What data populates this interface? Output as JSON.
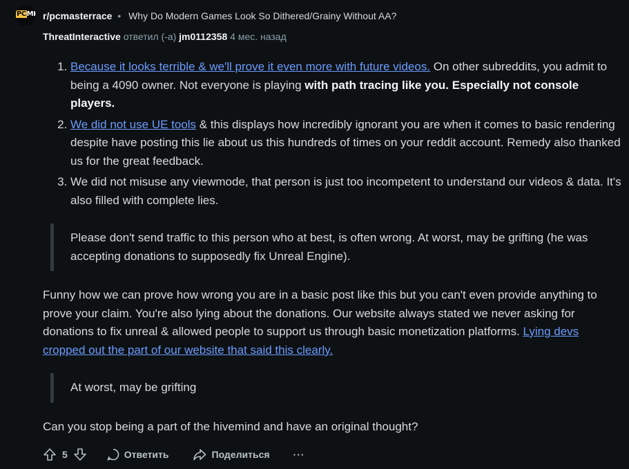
{
  "header": {
    "subreddit": "r/pcmasterrace",
    "separator": "•",
    "post_title": "Why Do Modern Games Look So Dithered/Grainy Without AA?",
    "author": "ThreatInteractive",
    "replied_text": "ответил (-а)",
    "reply_to": "jm0112358",
    "time_ago": "4 мес. назад",
    "avatar_text_a": "PC",
    "avatar_text_b": "MR"
  },
  "comment": {
    "list": [
      {
        "link": "Because it looks terrible & we'll prove it even more with future videos.",
        "text": " On other subreddits, you admit to being a 4090 owner. Not everyone is playing ",
        "bold": "with path tracing like you. Especially not console players."
      },
      {
        "link": "We did not use UE tools",
        "text": " & this displays how incredibly ignorant you are when it comes to basic rendering despite have posting this lie about us this hundreds of times on your reddit account. Remedy also thanked us for the great feedback."
      },
      {
        "text": "We did not misuse any viewmode, that person is just too incompetent to understand our videos & data. It's also filled with complete lies."
      }
    ],
    "quote1": "Please don't send traffic to this person who at best, is often wrong. At worst, may be grifting (he was accepting donations to supposedly fix Unreal Engine).",
    "para1_text": "Funny how we can prove how wrong you are in a basic post like this but you can't even provide anything to prove your claim. You're also lying about the donations. Our website always stated we never asking for donations to fix unreal & allowed people to support us through basic monetization platforms. ",
    "para1_link": "Lying devs cropped out the part of our website that said this clearly.",
    "quote2": "At worst, may be grifting",
    "para2": "Can you stop being a part of the hivemind and have an original thought?"
  },
  "actions": {
    "vote_count": "5",
    "reply_label": "Ответить",
    "share_label": "Поделиться",
    "more_label": "···"
  }
}
